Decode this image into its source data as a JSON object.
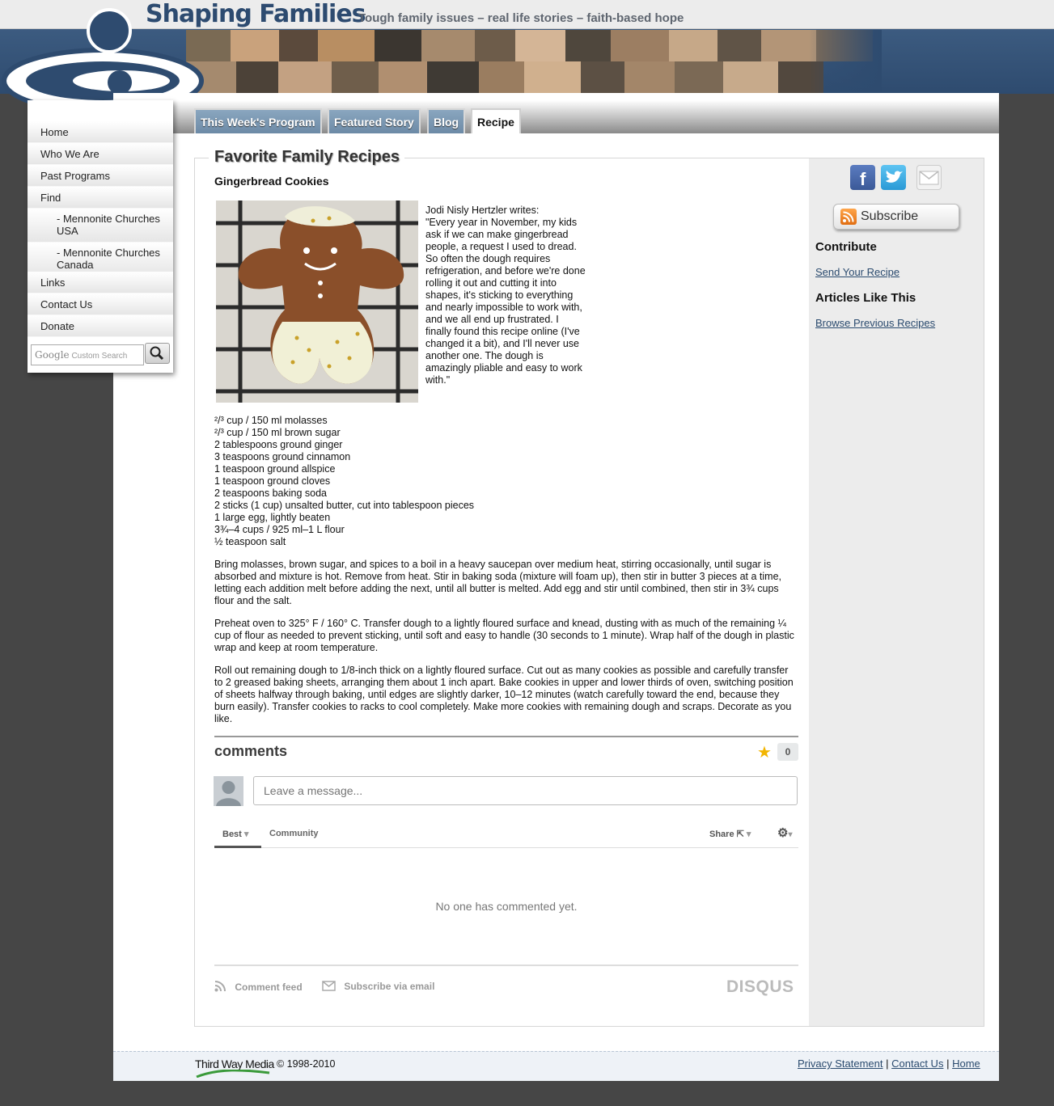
{
  "header": {
    "site_title": "Shaping Families",
    "tagline": "Tough family issues – real life stories – faith-based hope"
  },
  "tabs": [
    {
      "label": "This Week's Program",
      "active": false
    },
    {
      "label": "Featured Story",
      "active": false
    },
    {
      "label": "Blog",
      "active": false
    },
    {
      "label": "Recipe",
      "active": true
    }
  ],
  "sidebar": {
    "items": [
      {
        "label": "Home"
      },
      {
        "label": "Who We Are"
      },
      {
        "label": "Past Programs"
      },
      {
        "label": "Find"
      },
      {
        "label": "- Mennonite Churches USA"
      },
      {
        "label": "- Mennonite Churches Canada"
      },
      {
        "label": "Links"
      },
      {
        "label": "Contact Us"
      },
      {
        "label": "Donate"
      }
    ],
    "search": {
      "brand": "Google",
      "placeholder": "Custom Search"
    }
  },
  "main": {
    "section_title": "Favorite Family Recipes",
    "recipe_title": "Gingerbread Cookies",
    "intro_author": "Jodi Nisly Hertzler writes:",
    "intro_quote": "\"Every year in November, my kids ask if we can make gingerbread people, a request I used to dread. So often the dough requires refrigeration, and before we're done rolling it out and cutting it into shapes, it's sticking to everything and nearly impossible to work with, and we all end up frustrated. I finally found this recipe online (I've changed it a bit), and I'll never use another one. The dough is amazingly pliable and easy to work with.\"",
    "ingredients": [
      "²/³ cup / 150 ml molasses",
      "²/³ cup / 150 ml brown sugar",
      "2 tablespoons ground ginger",
      "3 teaspoons ground cinnamon",
      "1 teaspoon ground allspice",
      "1 teaspoon ground cloves",
      "2 teaspoons baking soda",
      "2 sticks (1 cup) unsalted butter, cut into tablespoon pieces",
      "1 large egg, lightly beaten",
      "3¾–4 cups / 925 ml–1 L flour",
      "½ teaspoon salt"
    ],
    "steps": [
      "Bring molasses, brown sugar, and spices to a boil in a heavy saucepan over medium heat, stirring occasionally, until sugar is absorbed and mixture is hot. Remove from heat. Stir in baking soda (mixture will foam up), then stir in butter 3 pieces at a time, letting each addition melt before adding the next, until all butter is melted. Add egg and stir until combined, then stir in 3¾ cups flour and the salt.",
      "Preheat oven to 325° F / 160° C. Transfer dough to a lightly floured surface and knead, dusting with as much of the remaining ¼ cup of flour as needed to prevent sticking, until soft and easy to handle (30 seconds to 1 minute). Wrap half of the dough in plastic wrap and keep at room temperature.",
      "Roll out remaining dough to 1/8-inch thick on a lightly floured surface. Cut out as many cookies as possible and carefully transfer to 2 greased baking sheets, arranging them about 1 inch apart. Bake cookies in upper and lower thirds of oven, switching position of sheets halfway through baking, until edges are slightly darker, 10–12 minutes (watch carefully toward the end, because they burn easily). Transfer cookies to racks to cool completely. Make more cookies with remaining dough and scraps. Decorate as you like."
    ]
  },
  "comments": {
    "heading": "comments",
    "count": "0",
    "input_placeholder": "Leave a message...",
    "tab_best": "Best",
    "tab_community": "Community",
    "share_label": "Share",
    "empty_message": "No one has commented yet.",
    "comment_feed": "Comment feed",
    "subscribe_email": "Subscribe via email",
    "brand": "DISQUS"
  },
  "right_column": {
    "share_icons": [
      "facebook-icon",
      "twitter-icon",
      "email-icon"
    ],
    "subscribe_label": "Subscribe",
    "contribute_heading": "Contribute",
    "send_recipe_link": "Send Your Recipe",
    "articles_heading": "Articles Like This",
    "browse_link": "Browse Previous Recipes"
  },
  "footer": {
    "brand": "Third Way Media",
    "copyright": "© 1998-2010",
    "links": [
      "Privacy Statement",
      "Contact Us",
      "Home"
    ],
    "separator": "|"
  },
  "colors": {
    "banner_blue": "#2e4b6f",
    "link": "#2a4a6e",
    "tab_blue": "#7896b1",
    "star": "#f2b500"
  }
}
